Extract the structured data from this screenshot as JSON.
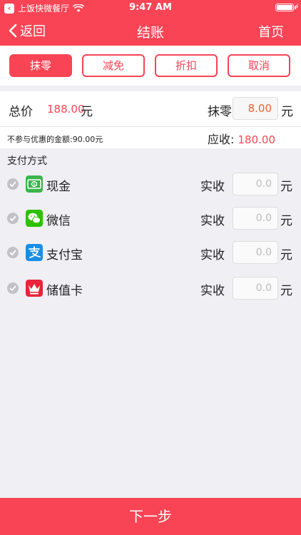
{
  "status": {
    "app_name": "上饭快微餐厅",
    "time": "9:47 AM"
  },
  "nav": {
    "back_label": "返回",
    "title": "结账",
    "home_label": "首页"
  },
  "tabs": [
    {
      "label": "抹零",
      "active": true
    },
    {
      "label": "减免",
      "active": false
    },
    {
      "label": "折扣",
      "active": false
    },
    {
      "label": "取消",
      "active": false
    }
  ],
  "summary": {
    "total_label": "总价",
    "total_value": "188.00",
    "total_unit": "元",
    "moling_label": "抹零",
    "moling_value": "8.00",
    "moling_unit": "元",
    "excluded_text": "不参与优惠的金额:90.00元",
    "due_label": "应收:",
    "due_value": "180.00"
  },
  "payment": {
    "title": "支付方式",
    "received_label": "实收",
    "unit": "元",
    "methods": [
      {
        "name": "现金",
        "value": "0.0",
        "icon": "cash-icon",
        "color": "#3bb54a"
      },
      {
        "name": "微信",
        "value": "0.0",
        "icon": "wechat-icon",
        "color": "#2dc100"
      },
      {
        "name": "支付宝",
        "value": "0.0",
        "icon": "alipay-icon",
        "color": "#1a8ee6"
      },
      {
        "name": "储值卡",
        "value": "0.0",
        "icon": "crown-icon",
        "color": "#e8243a"
      }
    ]
  },
  "footer": {
    "next_label": "下一步"
  },
  "colors": {
    "accent": "#f84455",
    "background": "#efeff4"
  }
}
